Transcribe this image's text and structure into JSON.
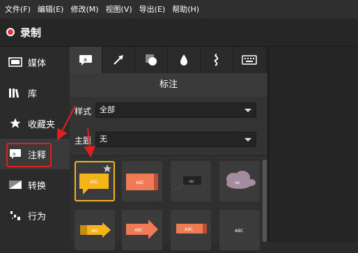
{
  "menu": [
    "文件(F)",
    "编辑(E)",
    "修改(M)",
    "视图(V)",
    "导出(E)",
    "帮助(H)"
  ],
  "record": {
    "label": "录制"
  },
  "sidebar": {
    "items": [
      {
        "label": "媒体",
        "icon": "film-icon"
      },
      {
        "label": "库",
        "icon": "library-icon"
      },
      {
        "label": "收藏夹",
        "icon": "star-icon"
      },
      {
        "label": "注释",
        "icon": "annotation-icon"
      },
      {
        "label": "转换",
        "icon": "transition-icon"
      },
      {
        "label": "行为",
        "icon": "behavior-icon"
      }
    ]
  },
  "panel": {
    "title": "标注",
    "tabs": [
      "callout-tab",
      "arrow-tab",
      "shape-tab",
      "blur-tab",
      "sketch-tab",
      "keyboard-tab"
    ],
    "style_label": "样式",
    "style_value": "全部",
    "theme_label": "主题",
    "theme_value": "无"
  },
  "gallery": {
    "tiles": [
      {
        "text": "ABC",
        "kind": "speech-yellow"
      },
      {
        "text": "ABC",
        "kind": "speech-orange"
      },
      {
        "text": "ABC",
        "kind": "dark-bubble"
      },
      {
        "text": "ABC",
        "kind": "cloud"
      },
      {
        "text": "ABC",
        "kind": "arrow-yellow"
      },
      {
        "text": "ABC",
        "kind": "arrow-orange"
      },
      {
        "text": "ABC",
        "kind": "banner-orange"
      },
      {
        "text": "ABC",
        "kind": "plain-text"
      }
    ]
  },
  "colors": {
    "accent_red": "#e02020",
    "selected_border": "#f0b322",
    "callout_yellow": "#f4b41a",
    "callout_orange": "#f07a55"
  }
}
